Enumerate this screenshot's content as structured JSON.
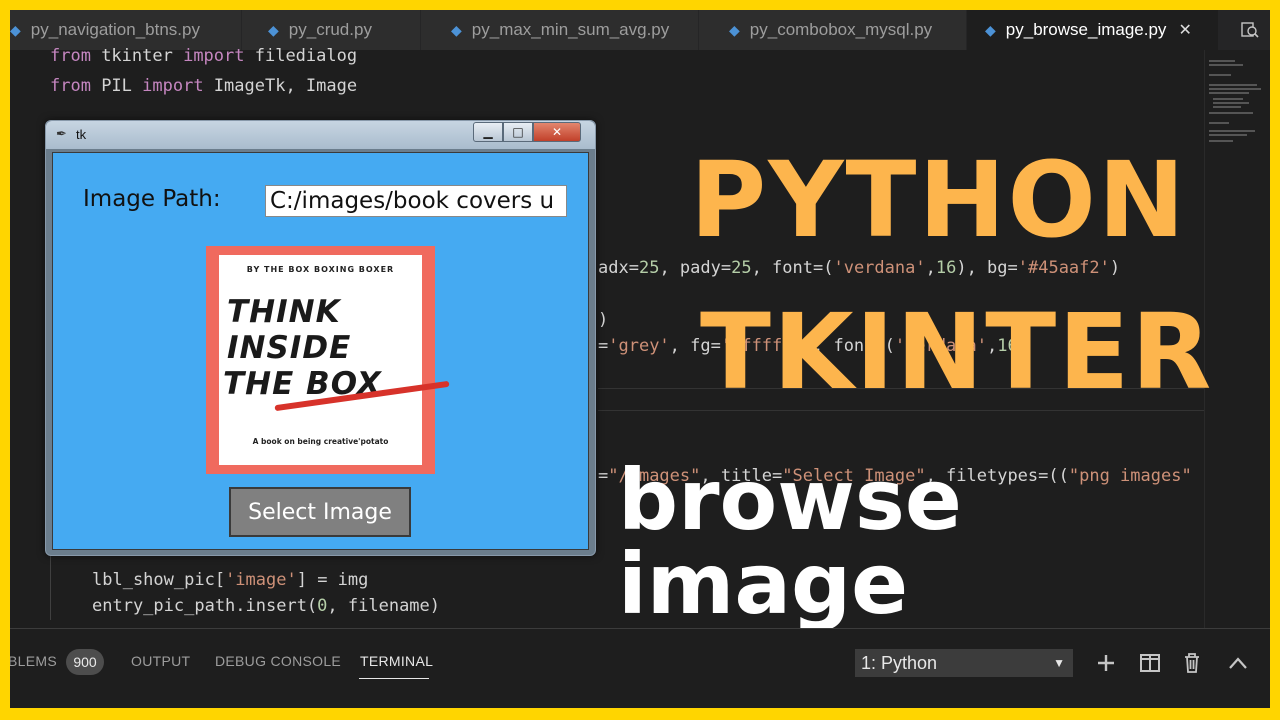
{
  "tabs": [
    {
      "label": "py_navigation_btns.py",
      "active": false
    },
    {
      "label": "py_crud.py",
      "active": false
    },
    {
      "label": "py_max_min_sum_avg.py",
      "active": false
    },
    {
      "label": "py_combobox_mysql.py",
      "active": false
    },
    {
      "label": "py_browse_image.py",
      "active": true
    }
  ],
  "editor": {
    "line1": {
      "kw1": "from",
      "mod": " tkinter ",
      "kw2": "import",
      "rest": " filedialog"
    },
    "line2": {
      "kw1": "from",
      "mod": " PIL ",
      "kw2": "import",
      "rest": " ImageTk, Image"
    },
    "line3": {
      "pre": "adx=",
      "n1": "25",
      "mid1": ", pady=",
      "n2": "25",
      "mid2": ", font=(",
      "s1": "'verdana'",
      "mid3": ",",
      "n3": "16",
      "mid4": "), bg=",
      "s2": "'#45aaf2'",
      "end": ")"
    },
    "line4": ")",
    "line5": {
      "pre": "=",
      "s1": "'grey'",
      "mid": ", fg=",
      "s2": "'#ffffff'",
      "mid2": ", font=(",
      "s3": "'verdana'",
      "mid3": ",",
      "n": "16",
      "end": ")"
    },
    "line6": {
      "pre": "=",
      "s1": "\"/images\"",
      "mid": ", title=",
      "s2": "\"Select Image\"",
      "mid2": ", filetypes=((",
      "s3": "\"png images\""
    },
    "line7": {
      "pre": "lbl_show_pic[",
      "s": "'image'",
      "end": "] = img"
    },
    "line8": {
      "pre": "entry_pic_path.insert(",
      "n": "0",
      "end": ", filename)"
    }
  },
  "overlay": {
    "line1": "PYTHON",
    "line2": "TKINTER",
    "line3": "browse image"
  },
  "tk_window": {
    "title": "tk",
    "label": "Image Path:",
    "entry_value": "C:/images/book covers u",
    "button_label": "Select Image",
    "bg_color": "#45aaf2",
    "cover": {
      "top_text": "BY THE BOX BOXING BOXER",
      "title_lines": [
        "THINK",
        "INSIDE",
        "THE BOX"
      ],
      "subtitle": "A book on being creative'potato"
    }
  },
  "panel": {
    "problems_label": "BLEMS",
    "problems_count": "900",
    "output_label": "OUTPUT",
    "debug_label": "DEBUG CONSOLE",
    "terminal_label": "TERMINAL",
    "terminal_select": "1: Python"
  }
}
